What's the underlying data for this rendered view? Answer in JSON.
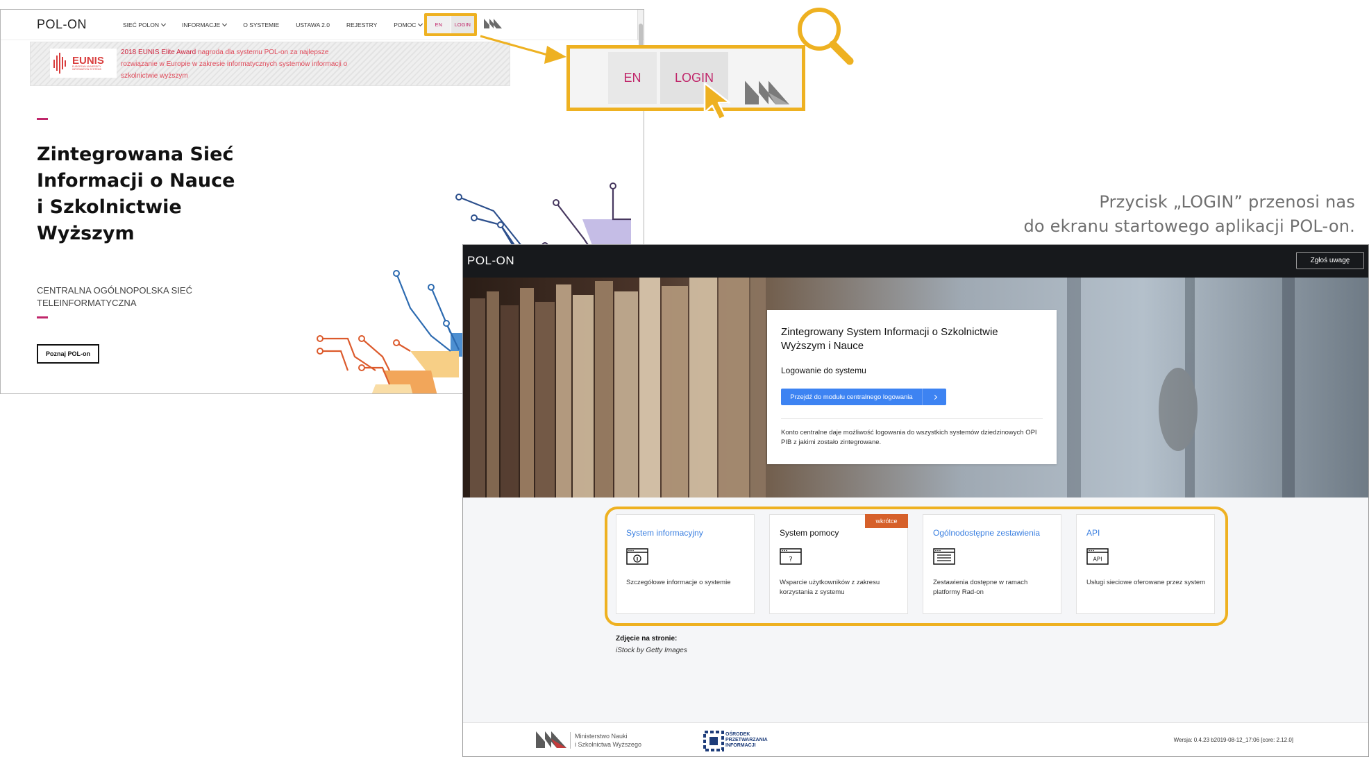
{
  "site": {
    "logo": "POL-ON",
    "nav": [
      {
        "label": "SIEĆ POLON",
        "dropdown": true
      },
      {
        "label": "INFORMACJE",
        "dropdown": true
      },
      {
        "label": "O SYSTEMIE",
        "dropdown": false
      },
      {
        "label": "USTAWA 2.0",
        "dropdown": false
      },
      {
        "label": "REJESTRY",
        "dropdown": false
      },
      {
        "label": "POMOC",
        "dropdown": true
      }
    ],
    "lang_label": "EN",
    "login_label": "LOGIN",
    "award": {
      "logo_text": "EUNIS",
      "logo_sub": "EUROPEAN UNIVERSITY INFORMATION SYSTEMS",
      "highlight": "2018 EUNIS Elite Award",
      "text": " nagroda dla systemu POL-on za najlepsze rozwiązanie w Europie w zakresie informatycznych systemów informacji o szkolnictwie wyższym"
    },
    "hero_title": "Zintegrowana Sieć Informacji o Nauce i Szkolnictwie Wyższym",
    "hero_subtitle": "CENTRALNA OGÓLNOPOLSKA SIEĆ TELEINFORMATYCZNA",
    "cta_label": "Poznaj POL-on"
  },
  "callout": {
    "en": "EN",
    "login": "LOGIN",
    "caption_line1": "Przycisk „LOGIN” przenosi nas",
    "caption_line2": "do ekranu startowego aplikacji POL-on."
  },
  "app": {
    "logo": "POL-ON",
    "report_button": "Zgłoś uwagę",
    "card": {
      "title": "Zintegrowany System Informacji o Szkolnictwie Wyższym i Nauce",
      "subtitle": "Logowanie do systemu",
      "button": "Przejdź do modułu centralnego logowania",
      "note": "Konto centralne daje możliwość logowania do wszystkich systemów dziedzinowych OPI PIB z jakimi zostało zintegrowane."
    },
    "tiles": [
      {
        "title": "System informacyjny",
        "desc": "Szczegółowe informacje o systemie",
        "icon": "info-window-icon"
      },
      {
        "title": "System pomocy",
        "desc": "Wsparcie użytkowników z zakresu korzystania z systemu",
        "icon": "help-window-icon",
        "badge": "wkrótce"
      },
      {
        "title": "Ogólnodostępne zestawienia",
        "desc": "Zestawienia dostępne w ramach platformy Rad-on",
        "icon": "list-window-icon"
      },
      {
        "title": "API",
        "desc": "Usługi sieciowe oferowane przez system",
        "icon": "api-window-icon",
        "icon_text": "API"
      }
    ],
    "photo_credit_label": "Zdjęcie na stronie:",
    "photo_credit": "iStock by Getty Images",
    "footer": {
      "ministry_line1": "Ministerstwo Nauki",
      "ministry_line2": "i Szkolnictwa Wyższego",
      "opi_line1": "OŚRODEK",
      "opi_line2": "PRZETWARZANIA",
      "opi_line3": "INFORMACJI",
      "version": "Wersja: 0.4.23 b2019-08-12_17:06 [core: 2.12.0]"
    }
  },
  "colors": {
    "accent_yellow": "#eeb121",
    "polon_pink": "#c0266a",
    "link_blue": "#3a7fe0",
    "button_blue": "#3d83f2",
    "badge_orange": "#d6602a"
  }
}
